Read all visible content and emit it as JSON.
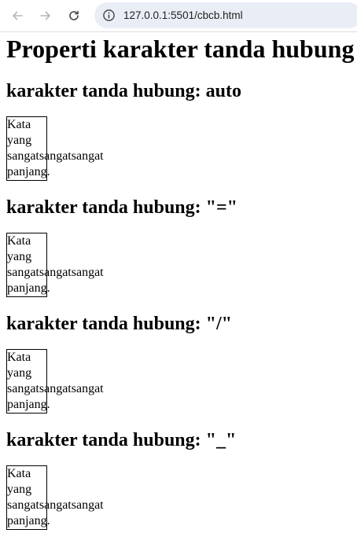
{
  "browser": {
    "url": "127.0.0.1:5501/cbcb.html",
    "icons": [
      "back-arrow-icon",
      "forward-arrow-icon",
      "reload-icon",
      "info-icon"
    ]
  },
  "page": {
    "title": "Properti karakter tanda hubung",
    "sections": [
      {
        "heading": "karakter tanda hubung: auto",
        "lines": [
          "Kata",
          "yang",
          "sangatsangatsangat",
          "panjang."
        ]
      },
      {
        "heading": "karakter tanda hubung: \"=\"",
        "lines": [
          "Kata",
          "yang",
          "sangatsangatsangat",
          "panjang."
        ]
      },
      {
        "heading": "karakter tanda hubung: \"/\"",
        "lines": [
          "Kata",
          "yang",
          "sangatsangatsangat",
          "panjang."
        ]
      },
      {
        "heading": "karakter tanda hubung: \"_\"",
        "lines": [
          "Kata",
          "yang",
          "sangatsangatsangat",
          "panjang."
        ]
      }
    ]
  }
}
